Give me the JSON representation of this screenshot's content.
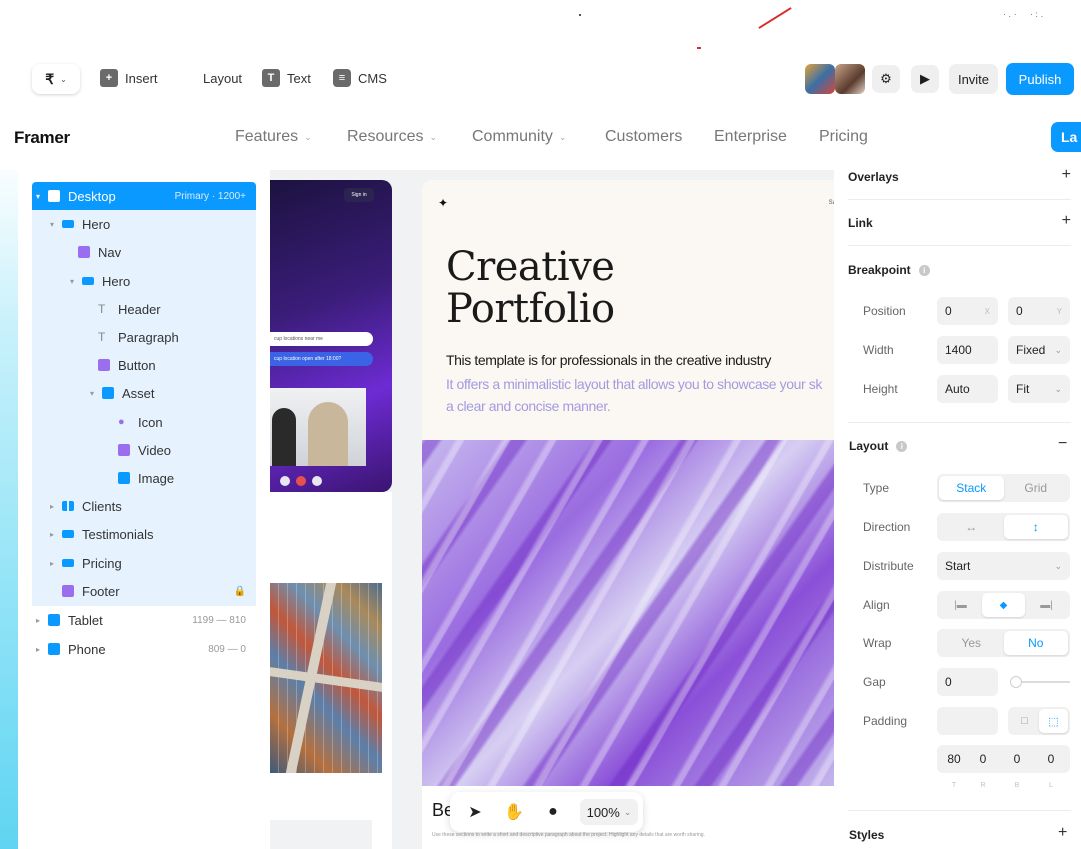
{
  "toolbar": {
    "logo_icon": "framer-logo-icon",
    "insert": "Insert",
    "layout": "Layout",
    "text": "Text",
    "text_icon": "T",
    "cms": "CMS",
    "invite": "Invite",
    "publish": "Publish",
    "accent": "#0a99ff"
  },
  "site_nav": {
    "logo": "Framer",
    "items": [
      "Features",
      "Resources",
      "Community",
      "Customers",
      "Enterprise",
      "Pricing"
    ],
    "cta_partial": "La"
  },
  "layers": [
    {
      "label": "Desktop",
      "meta": "Primary · 1200+"
    },
    {
      "label": "Hero"
    },
    {
      "label": "Nav"
    },
    {
      "label": "Hero"
    },
    {
      "label": "Header"
    },
    {
      "label": "Paragraph"
    },
    {
      "label": "Button"
    },
    {
      "label": "Asset"
    },
    {
      "label": "Icon"
    },
    {
      "label": "Video"
    },
    {
      "label": "Image"
    },
    {
      "label": "Clients"
    },
    {
      "label": "Testimonials"
    },
    {
      "label": "Pricing"
    },
    {
      "label": "Footer"
    },
    {
      "label": "Tablet",
      "meta": "1199 — 810"
    },
    {
      "label": "Phone",
      "meta": "809 — 0"
    }
  ],
  "canvas": {
    "left_frame": {
      "signin": "Sign in",
      "pill1": "cup locations near me",
      "pill2": "cup location open after 18:00?"
    },
    "main_frame": {
      "title_line1": "Creative",
      "title_line2": "Portfolio",
      "corner": "Sa",
      "desc1": "This template is for professionals in the creative industry",
      "desc2": "It offers a minimalistic layout that allows you to showcase your sk",
      "desc3": "a clear and concise manner.",
      "bottom_heading": "Be",
      "bottom_small": "Use these sections to write a short and descriptive paragraph about the project. Highlight any details that are worth sharing."
    },
    "zoom": "100%"
  },
  "props": {
    "overlays": "Overlays",
    "link": "Link",
    "breakpoint": "Breakpoint",
    "position_label": "Position",
    "position_x": "0",
    "position_x_suffix": "X",
    "position_y": "0",
    "position_y_suffix": "Y",
    "width_label": "Width",
    "width_value": "1400",
    "width_mode": "Fixed",
    "height_label": "Height",
    "height_value": "Auto",
    "height_mode": "Fit",
    "layout": "Layout",
    "type_label": "Type",
    "type_options": [
      "Stack",
      "Grid"
    ],
    "direction_label": "Direction",
    "distribute_label": "Distribute",
    "distribute_value": "Start",
    "align_label": "Align",
    "wrap_label": "Wrap",
    "wrap_options": [
      "Yes",
      "No"
    ],
    "gap_label": "Gap",
    "gap_value": "0",
    "padding_label": "Padding",
    "padding_values": [
      "80",
      "0",
      "0",
      "0"
    ],
    "padding_sides": [
      "T",
      "R",
      "B",
      "L"
    ],
    "styles": "Styles"
  }
}
